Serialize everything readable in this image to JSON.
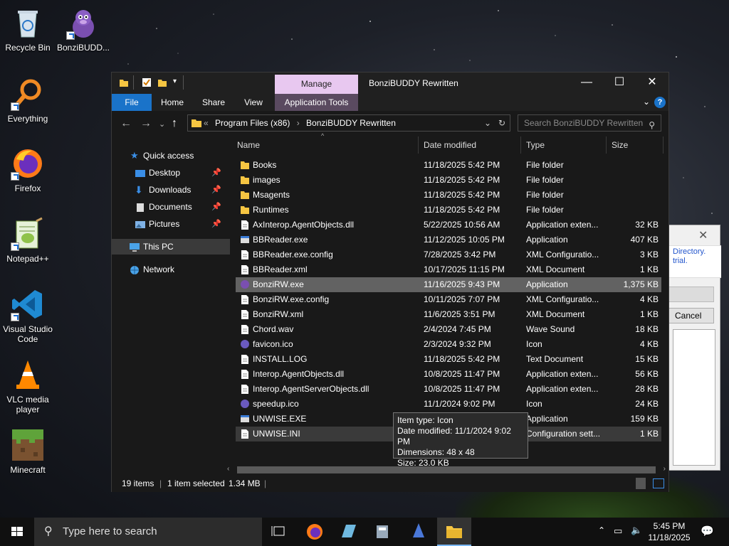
{
  "desktop": {
    "icons": [
      {
        "label": "Recycle Bin"
      },
      {
        "label": "BonziBUDD..."
      },
      {
        "label": "Everything"
      },
      {
        "label": "Firefox"
      },
      {
        "label": "Notepad++"
      },
      {
        "label": "Visual Studio Code"
      },
      {
        "label": "VLC media player"
      },
      {
        "label": "Minecraft"
      }
    ]
  },
  "background_dialog": {
    "message": "Directory. trial.",
    "cancel_label": "Cancel"
  },
  "explorer": {
    "title": "BonziBUDDY Rewritten",
    "manage_tab": "Manage",
    "ribbon_tabs": {
      "file": "File",
      "home": "Home",
      "share": "Share",
      "view": "View",
      "app_tools": "Application Tools"
    },
    "breadcrumb": {
      "prefix": "«",
      "part1": "Program Files (x86)",
      "sep": "›",
      "part2": "BonziBUDDY Rewritten"
    },
    "search_placeholder": "Search BonziBUDDY Rewritten",
    "nav": {
      "quick_access": "Quick access",
      "desktop": "Desktop",
      "downloads": "Downloads",
      "documents": "Documents",
      "pictures": "Pictures",
      "this_pc": "This PC",
      "network": "Network"
    },
    "columns": {
      "name": "Name",
      "date": "Date modified",
      "type": "Type",
      "size": "Size"
    },
    "files": [
      {
        "name": "Books",
        "date": "11/18/2025 5:42 PM",
        "type": "File folder",
        "size": ""
      },
      {
        "name": "images",
        "date": "11/18/2025 5:42 PM",
        "type": "File folder",
        "size": ""
      },
      {
        "name": "Msagents",
        "date": "11/18/2025 5:42 PM",
        "type": "File folder",
        "size": ""
      },
      {
        "name": "Runtimes",
        "date": "11/18/2025 5:42 PM",
        "type": "File folder",
        "size": ""
      },
      {
        "name": "AxInterop.AgentObjects.dll",
        "date": "5/22/2025 10:56 AM",
        "type": "Application exten...",
        "size": "32 KB"
      },
      {
        "name": "BBReader.exe",
        "date": "11/12/2025 10:05 PM",
        "type": "Application",
        "size": "407 KB"
      },
      {
        "name": "BBReader.exe.config",
        "date": "7/28/2025 3:42 PM",
        "type": "XML Configuratio...",
        "size": "3 KB"
      },
      {
        "name": "BBReader.xml",
        "date": "10/17/2025 11:15 PM",
        "type": "XML Document",
        "size": "1 KB"
      },
      {
        "name": "BonziRW.exe",
        "date": "11/16/2025 9:43 PM",
        "type": "Application",
        "size": "1,375 KB"
      },
      {
        "name": "BonziRW.exe.config",
        "date": "10/11/2025 7:07 PM",
        "type": "XML Configuratio...",
        "size": "4 KB"
      },
      {
        "name": "BonziRW.xml",
        "date": "11/6/2025 3:51 PM",
        "type": "XML Document",
        "size": "1 KB"
      },
      {
        "name": "Chord.wav",
        "date": "2/4/2024 7:45 PM",
        "type": "Wave Sound",
        "size": "18 KB"
      },
      {
        "name": "favicon.ico",
        "date": "2/3/2024 9:32 PM",
        "type": "Icon",
        "size": "4 KB"
      },
      {
        "name": "INSTALL.LOG",
        "date": "11/18/2025 5:42 PM",
        "type": "Text Document",
        "size": "15 KB"
      },
      {
        "name": "Interop.AgentObjects.dll",
        "date": "10/8/2025 11:47 PM",
        "type": "Application exten...",
        "size": "56 KB"
      },
      {
        "name": "Interop.AgentServerObjects.dll",
        "date": "10/8/2025 11:47 PM",
        "type": "Application exten...",
        "size": "28 KB"
      },
      {
        "name": "speedup.ico",
        "date": "11/1/2024 9:02 PM",
        "type": "Icon",
        "size": "24 KB"
      },
      {
        "name": "UNWISE.EXE",
        "date": "",
        "type": "Application",
        "size": "159 KB"
      },
      {
        "name": "UNWISE.INI",
        "date": "",
        "type": "Configuration sett...",
        "size": "1 KB"
      }
    ],
    "status": {
      "items": "19 items",
      "selected": "1 item selected",
      "size": "1.34 MB"
    },
    "tooltip": {
      "line1": "Item type: Icon",
      "line2": "Date modified: 11/1/2024 9:02 PM",
      "line3": "Dimensions: 48 x 48",
      "line4": "Size: 23.0 KB"
    }
  },
  "taskbar": {
    "search_placeholder": "Type here to search",
    "time": "5:45 PM",
    "date": "11/18/2025"
  },
  "colors": {
    "accent": "#1a73c9",
    "manage_tab": "#e8c8f0",
    "folder": "#f5c542"
  }
}
